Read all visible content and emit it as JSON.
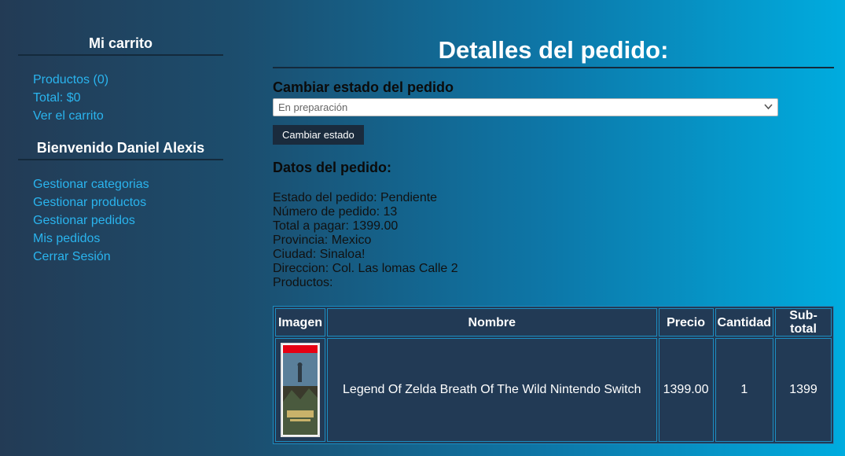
{
  "sidebar": {
    "cart_heading": "Mi carrito",
    "cart_items": [
      "Productos (0)",
      "Total: $0",
      "Ver el carrito"
    ],
    "welcome_heading": "Bienvenido Daniel Alexis",
    "user_items": [
      "Gestionar categorias",
      "Gestionar productos",
      "Gestionar pedidos",
      "Mis pedidos",
      "Cerrar Sesión"
    ]
  },
  "main": {
    "title": "Detalles del pedido:",
    "change_state_heading": "Cambiar estado del pedido",
    "state_select_value": "En preparación",
    "change_state_button": "Cambiar estado",
    "data_heading": "Datos del pedido:",
    "order_info": [
      "Estado del pedido: Pendiente",
      "Número de pedido: 13",
      "Total a pagar: 1399.00",
      "Provincia: Mexico",
      "Ciudad: Sinaloa!",
      "Direccion: Col. Las lomas Calle 2",
      "Productos:"
    ],
    "table": {
      "headers": [
        "Imagen",
        "Nombre",
        "Precio",
        "Cantidad",
        "Sub-total"
      ],
      "rows": [
        {
          "name": "Legend Of Zelda Breath Of The Wild Nintendo Switch",
          "price": "1399.00",
          "quantity": "1",
          "subtotal": "1399"
        }
      ]
    }
  },
  "colors": {
    "link": "#2ab4ee",
    "heading_white": "#ffffff",
    "table_bg": "#223a55",
    "table_border": "#1c8ec2",
    "button_bg": "#1a2b3d"
  },
  "icons": {
    "select_arrow": "chevron-down-icon",
    "product_image": "zelda-cover-image"
  }
}
